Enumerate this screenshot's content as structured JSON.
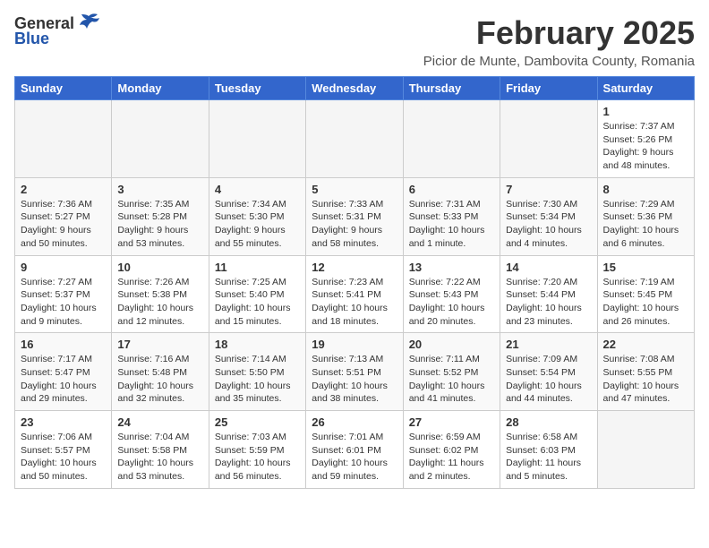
{
  "logo": {
    "general": "General",
    "blue": "Blue",
    "bird_symbol": "🐦"
  },
  "title": "February 2025",
  "subtitle": "Picior de Munte, Dambovita County, Romania",
  "days_header": [
    "Sunday",
    "Monday",
    "Tuesday",
    "Wednesday",
    "Thursday",
    "Friday",
    "Saturday"
  ],
  "weeks": [
    [
      {
        "day": "",
        "info": "",
        "empty": true
      },
      {
        "day": "",
        "info": "",
        "empty": true
      },
      {
        "day": "",
        "info": "",
        "empty": true
      },
      {
        "day": "",
        "info": "",
        "empty": true
      },
      {
        "day": "",
        "info": "",
        "empty": true
      },
      {
        "day": "",
        "info": "",
        "empty": true
      },
      {
        "day": "1",
        "info": "Sunrise: 7:37 AM\nSunset: 5:26 PM\nDaylight: 9 hours and 48 minutes."
      }
    ],
    [
      {
        "day": "2",
        "info": "Sunrise: 7:36 AM\nSunset: 5:27 PM\nDaylight: 9 hours and 50 minutes."
      },
      {
        "day": "3",
        "info": "Sunrise: 7:35 AM\nSunset: 5:28 PM\nDaylight: 9 hours and 53 minutes."
      },
      {
        "day": "4",
        "info": "Sunrise: 7:34 AM\nSunset: 5:30 PM\nDaylight: 9 hours and 55 minutes."
      },
      {
        "day": "5",
        "info": "Sunrise: 7:33 AM\nSunset: 5:31 PM\nDaylight: 9 hours and 58 minutes."
      },
      {
        "day": "6",
        "info": "Sunrise: 7:31 AM\nSunset: 5:33 PM\nDaylight: 10 hours and 1 minute."
      },
      {
        "day": "7",
        "info": "Sunrise: 7:30 AM\nSunset: 5:34 PM\nDaylight: 10 hours and 4 minutes."
      },
      {
        "day": "8",
        "info": "Sunrise: 7:29 AM\nSunset: 5:36 PM\nDaylight: 10 hours and 6 minutes."
      }
    ],
    [
      {
        "day": "9",
        "info": "Sunrise: 7:27 AM\nSunset: 5:37 PM\nDaylight: 10 hours and 9 minutes."
      },
      {
        "day": "10",
        "info": "Sunrise: 7:26 AM\nSunset: 5:38 PM\nDaylight: 10 hours and 12 minutes."
      },
      {
        "day": "11",
        "info": "Sunrise: 7:25 AM\nSunset: 5:40 PM\nDaylight: 10 hours and 15 minutes."
      },
      {
        "day": "12",
        "info": "Sunrise: 7:23 AM\nSunset: 5:41 PM\nDaylight: 10 hours and 18 minutes."
      },
      {
        "day": "13",
        "info": "Sunrise: 7:22 AM\nSunset: 5:43 PM\nDaylight: 10 hours and 20 minutes."
      },
      {
        "day": "14",
        "info": "Sunrise: 7:20 AM\nSunset: 5:44 PM\nDaylight: 10 hours and 23 minutes."
      },
      {
        "day": "15",
        "info": "Sunrise: 7:19 AM\nSunset: 5:45 PM\nDaylight: 10 hours and 26 minutes."
      }
    ],
    [
      {
        "day": "16",
        "info": "Sunrise: 7:17 AM\nSunset: 5:47 PM\nDaylight: 10 hours and 29 minutes."
      },
      {
        "day": "17",
        "info": "Sunrise: 7:16 AM\nSunset: 5:48 PM\nDaylight: 10 hours and 32 minutes."
      },
      {
        "day": "18",
        "info": "Sunrise: 7:14 AM\nSunset: 5:50 PM\nDaylight: 10 hours and 35 minutes."
      },
      {
        "day": "19",
        "info": "Sunrise: 7:13 AM\nSunset: 5:51 PM\nDaylight: 10 hours and 38 minutes."
      },
      {
        "day": "20",
        "info": "Sunrise: 7:11 AM\nSunset: 5:52 PM\nDaylight: 10 hours and 41 minutes."
      },
      {
        "day": "21",
        "info": "Sunrise: 7:09 AM\nSunset: 5:54 PM\nDaylight: 10 hours and 44 minutes."
      },
      {
        "day": "22",
        "info": "Sunrise: 7:08 AM\nSunset: 5:55 PM\nDaylight: 10 hours and 47 minutes."
      }
    ],
    [
      {
        "day": "23",
        "info": "Sunrise: 7:06 AM\nSunset: 5:57 PM\nDaylight: 10 hours and 50 minutes."
      },
      {
        "day": "24",
        "info": "Sunrise: 7:04 AM\nSunset: 5:58 PM\nDaylight: 10 hours and 53 minutes."
      },
      {
        "day": "25",
        "info": "Sunrise: 7:03 AM\nSunset: 5:59 PM\nDaylight: 10 hours and 56 minutes."
      },
      {
        "day": "26",
        "info": "Sunrise: 7:01 AM\nSunset: 6:01 PM\nDaylight: 10 hours and 59 minutes."
      },
      {
        "day": "27",
        "info": "Sunrise: 6:59 AM\nSunset: 6:02 PM\nDaylight: 11 hours and 2 minutes."
      },
      {
        "day": "28",
        "info": "Sunrise: 6:58 AM\nSunset: 6:03 PM\nDaylight: 11 hours and 5 minutes."
      },
      {
        "day": "",
        "info": "",
        "empty": true
      }
    ]
  ]
}
